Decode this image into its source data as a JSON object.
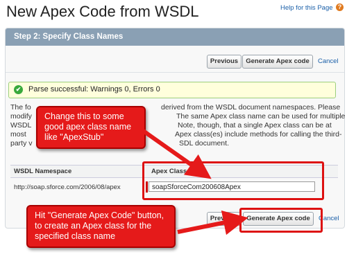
{
  "page": {
    "title": "New Apex Code from WSDL",
    "help_link": "Help for this Page"
  },
  "panel": {
    "step_title": "Step 2: Specify Class Names"
  },
  "buttons": {
    "previous": "Previous",
    "generate": "Generate Apex code",
    "cancel": "Cancel"
  },
  "status": {
    "message": "Parse successful: Warnings 0, Errors 0"
  },
  "description": [
    "The fo",
    "modify",
    "WSDL",
    "most",
    "party v"
  ],
  "description_right": [
    "derived from the WSDL document namespaces. Please",
    "The same Apex class name can be used for multiple",
    "Note, though, that a single Apex class can be at",
    "Apex class(es) include methods for calling the third-",
    "SDL document."
  ],
  "table": {
    "headers": [
      "WSDL Namespace",
      "Apex Class Name"
    ],
    "rows": [
      {
        "namespace": "http://soap.sforce.com/2006/08/apex",
        "class_name": "soapSforceCom200608Apex"
      }
    ]
  },
  "callouts": {
    "top": "Change this to some good apex class name like \"ApexStub\"",
    "bottom": "Hit \"Generate Apex Code\" button, to create an Apex class for the specified class name"
  },
  "colors": {
    "callout": "#e51a1a",
    "header": "#8aa0b4",
    "success": "#39a93b"
  }
}
